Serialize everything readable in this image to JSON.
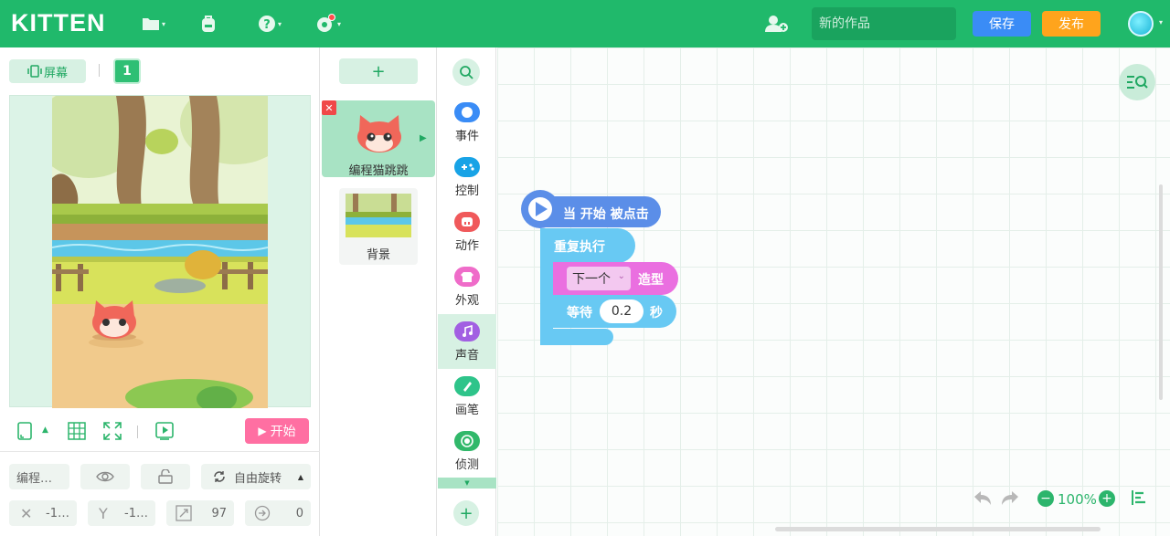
{
  "app": {
    "logo": "KITTEN"
  },
  "topbar": {
    "icons": [
      "folder-icon",
      "backpack-icon",
      "help-icon",
      "settings-icon"
    ],
    "title_placeholder": "新的作品",
    "save_label": "保存",
    "publish_label": "发布"
  },
  "stage": {
    "screen_label": "屏幕",
    "scene_number": "1",
    "start_label": "开始"
  },
  "properties": {
    "name": "编程…",
    "rotation_label": "自由旋转",
    "x_value": "-1…",
    "y_value": "-1…",
    "size_value": "97",
    "direction_value": "0"
  },
  "sprites": {
    "add_label": "+",
    "items": [
      {
        "name": "编程猫跳跳"
      },
      {
        "name": "背景"
      }
    ]
  },
  "categories": [
    {
      "label": "事件",
      "color": "#3a8cf6"
    },
    {
      "label": "控制",
      "color": "#18a3e6"
    },
    {
      "label": "动作",
      "color": "#f0595b"
    },
    {
      "label": "外观",
      "color": "#ef6cc9"
    },
    {
      "label": "声音",
      "color": "#a25fe2"
    },
    {
      "label": "画笔",
      "color": "#2ec48a"
    },
    {
      "label": "侦测",
      "color": "#31b86a"
    }
  ],
  "blocks": {
    "hat_label": "当 开始 被点击",
    "repeat_label": "重复执行",
    "next_costume_option": "下一个",
    "costume_label": "造型",
    "wait_label": "等待",
    "wait_value": "0.2",
    "seconds_label": "秒"
  },
  "workspace": {
    "zoom_label": "100%"
  },
  "colors": {
    "brand": "#20b96b",
    "save": "#3a8cf6",
    "publish": "#ffa41c",
    "start": "#ff6fa2",
    "event_block": "#5b8ee8",
    "control_block": "#68c9f3",
    "looks_block": "#ea6fe0"
  }
}
